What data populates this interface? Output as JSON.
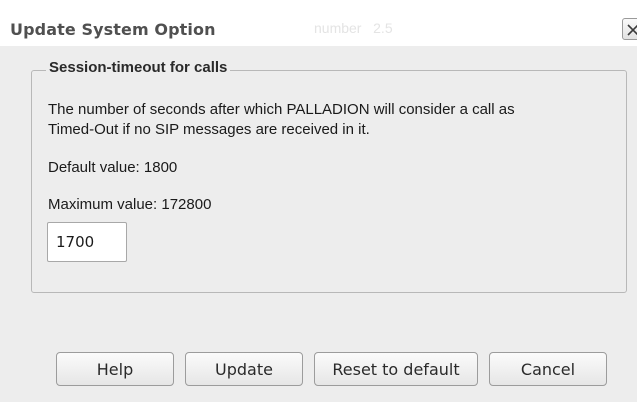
{
  "dialog": {
    "title": "Update System Option",
    "ghost_text": "number   2.5",
    "close_icon": "close-icon"
  },
  "group": {
    "legend": "Session-timeout for calls",
    "description_line1": "The number of seconds after which PALLADION will consider a call as",
    "description_line2": "Timed-Out if no SIP messages are received in it.",
    "default_value": "Default value: 1800",
    "maximum_value": "Maximum value: 172800"
  },
  "input": {
    "value": "1700"
  },
  "buttons": {
    "help": "Help",
    "update": "Update",
    "reset": "Reset to default",
    "cancel": "Cancel"
  }
}
